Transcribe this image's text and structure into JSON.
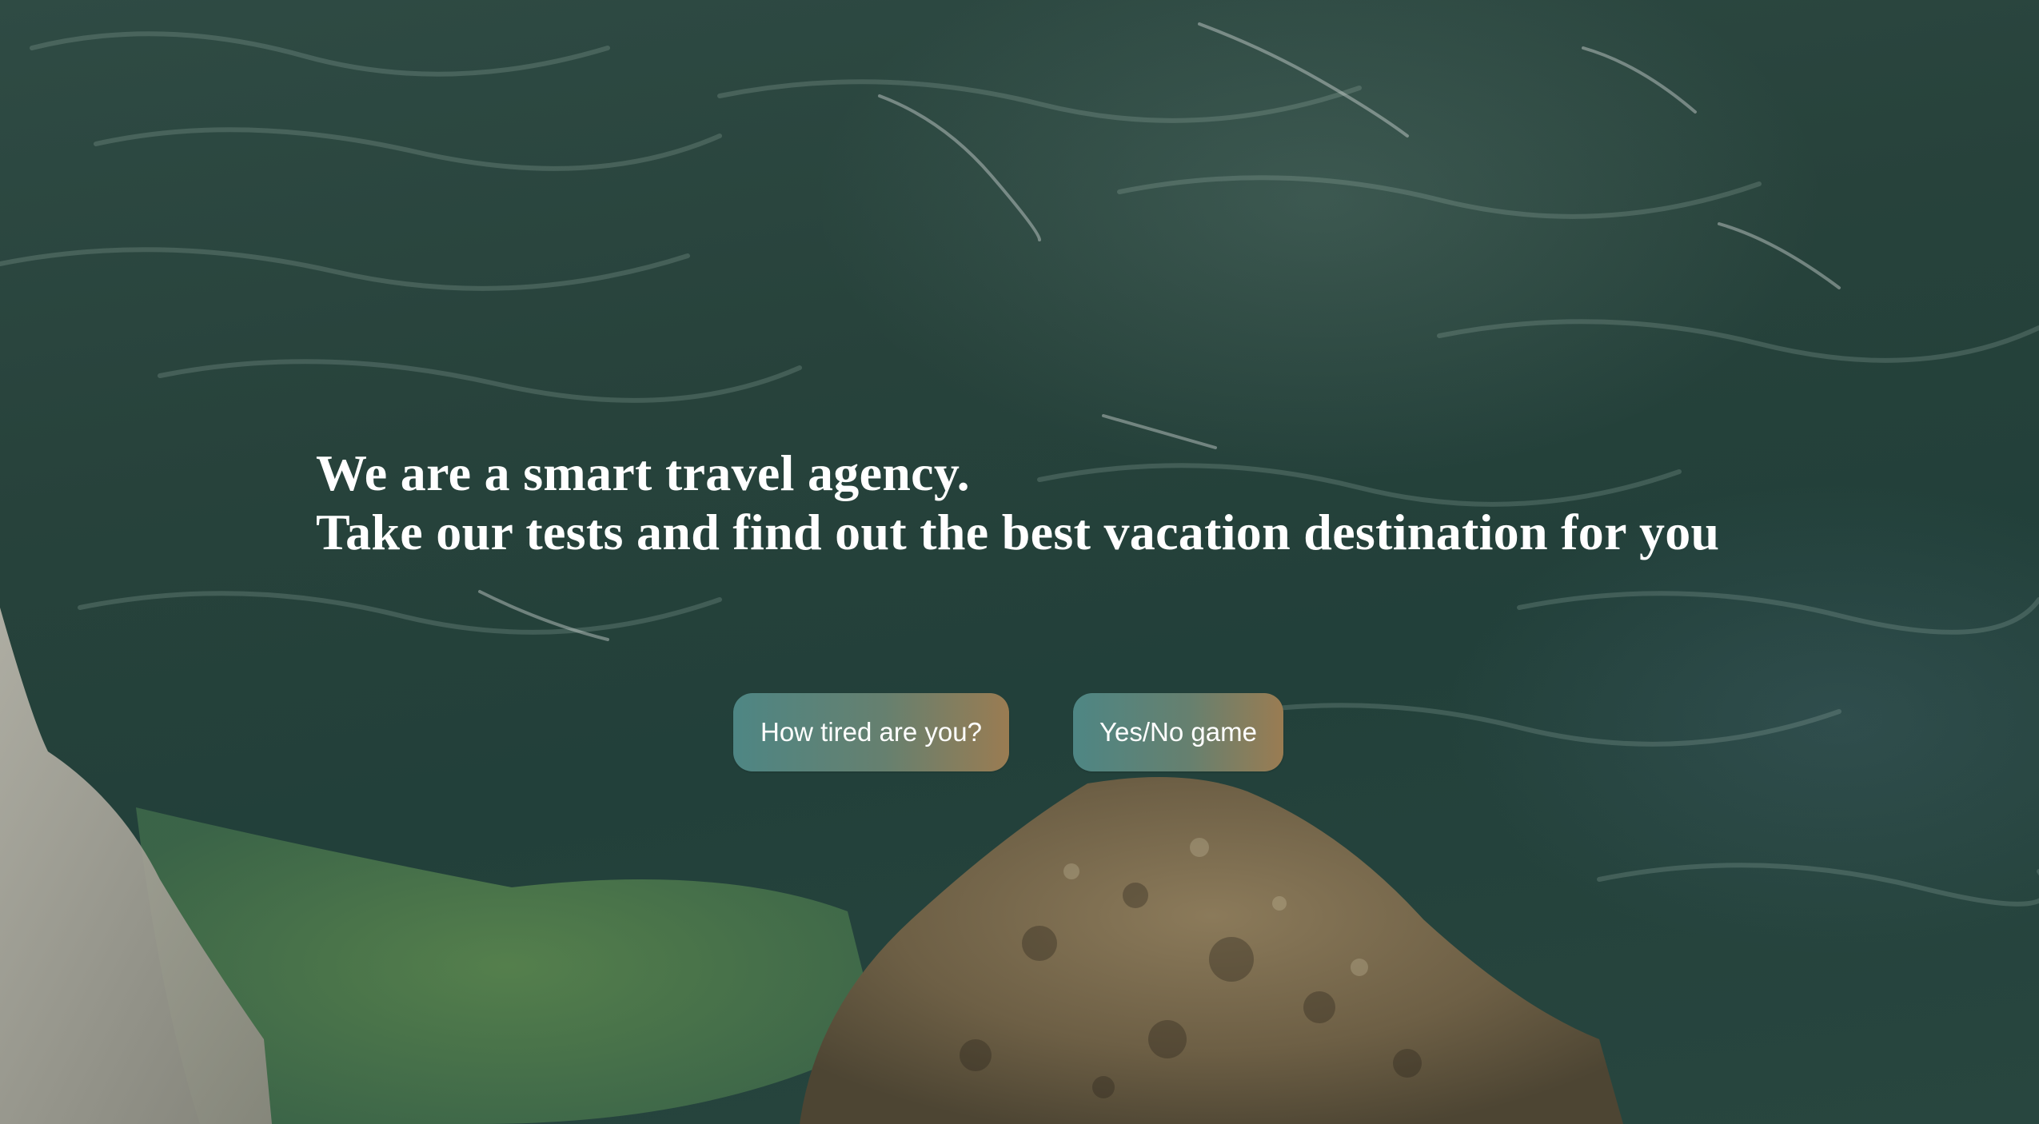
{
  "hero": {
    "line1": "We are a smart travel agency.",
    "line2": "Take our tests and find out the best vacation destination for you"
  },
  "buttons": {
    "tired_label": "How tired are you?",
    "yesno_label": "Yes/No game"
  },
  "background": {
    "description_icon": "sea-and-rocks-photo",
    "water_color": "#24413a",
    "rock_color": "#7a6a4e",
    "shallow_color": "#4f7a4a"
  },
  "theme": {
    "button_gradient_start": "#4e8684",
    "button_gradient_end": "#9a7c52",
    "text_color": "#ffffff"
  }
}
